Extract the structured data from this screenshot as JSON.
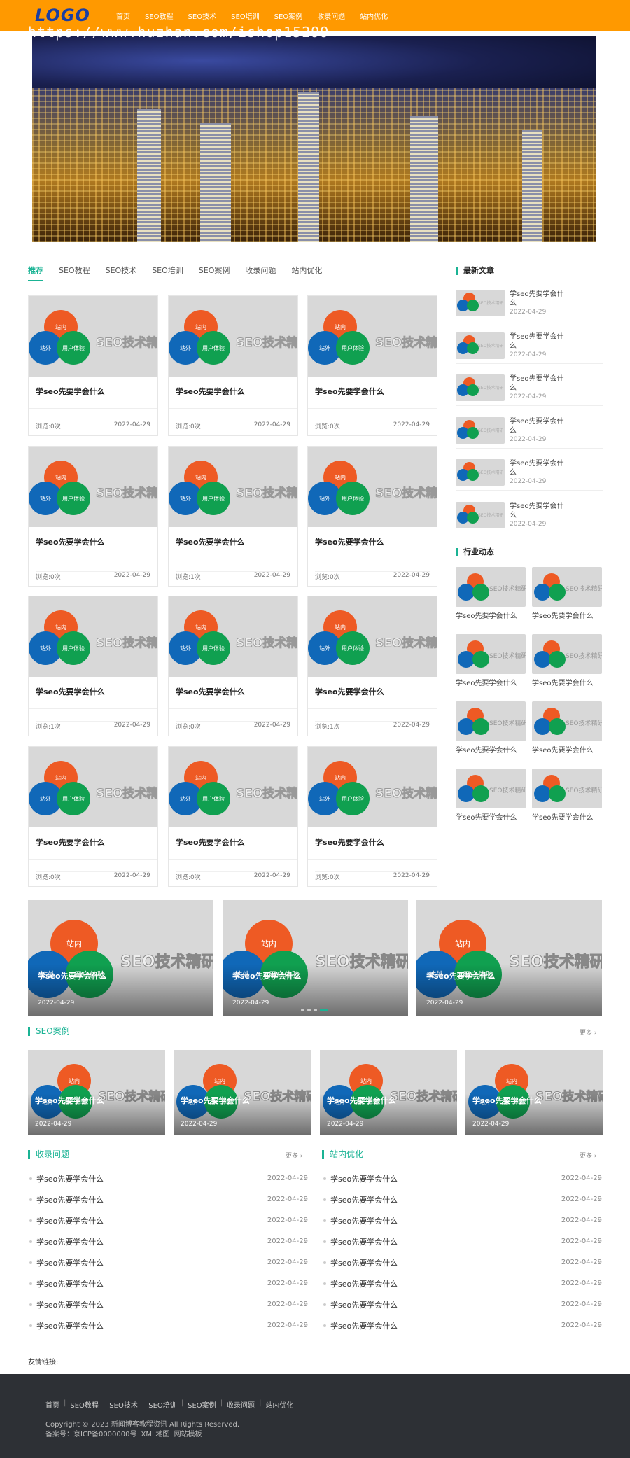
{
  "header": {
    "logo": "LOGO",
    "nav": [
      "首页",
      "SEO教程",
      "SEO技术",
      "SEO培训",
      "SEO案例",
      "收录问题",
      "站内优化"
    ]
  },
  "watermark": "https://www.huzhan.com/ishop15299",
  "tabs": [
    "推荐",
    "SEO教程",
    "SEO技术",
    "SEO培训",
    "SEO案例",
    "收录问题",
    "站内优化"
  ],
  "thumb": {
    "c1": "站内",
    "c2": "站外",
    "c3": "用户体验",
    "word": "SEO技术精研"
  },
  "cards": [
    {
      "title": "学seo先要学会什么",
      "views": "浏览:0次",
      "date": "2022-04-29"
    },
    {
      "title": "学seo先要学会什么",
      "views": "浏览:0次",
      "date": "2022-04-29"
    },
    {
      "title": "学seo先要学会什么",
      "views": "浏览:0次",
      "date": "2022-04-29"
    },
    {
      "title": "学seo先要学会什么",
      "views": "浏览:0次",
      "date": "2022-04-29"
    },
    {
      "title": "学seo先要学会什么",
      "views": "浏览:1次",
      "date": "2022-04-29"
    },
    {
      "title": "学seo先要学会什么",
      "views": "浏览:0次",
      "date": "2022-04-29"
    },
    {
      "title": "学seo先要学会什么",
      "views": "浏览:1次",
      "date": "2022-04-29"
    },
    {
      "title": "学seo先要学会什么",
      "views": "浏览:0次",
      "date": "2022-04-29"
    },
    {
      "title": "学seo先要学会什么",
      "views": "浏览:1次",
      "date": "2022-04-29"
    },
    {
      "title": "学seo先要学会什么",
      "views": "浏览:0次",
      "date": "2022-04-29"
    },
    {
      "title": "学seo先要学会什么",
      "views": "浏览:0次",
      "date": "2022-04-29"
    },
    {
      "title": "学seo先要学会什么",
      "views": "浏览:0次",
      "date": "2022-04-29"
    }
  ],
  "sidebar": {
    "latest_title": "最新文章",
    "latest": [
      {
        "title": "学seo先要学会什么",
        "date": "2022-04-29"
      },
      {
        "title": "学seo先要学会什么",
        "date": "2022-04-29"
      },
      {
        "title": "学seo先要学会什么",
        "date": "2022-04-29"
      },
      {
        "title": "学seo先要学会什么",
        "date": "2022-04-29"
      },
      {
        "title": "学seo先要学会什么",
        "date": "2022-04-29"
      },
      {
        "title": "学seo先要学会什么",
        "date": "2022-04-29"
      }
    ],
    "industry_title": "行业动态",
    "industry": [
      "学seo先要学会什么",
      "学seo先要学会什么",
      "学seo先要学会什么",
      "学seo先要学会什么",
      "学seo先要学会什么",
      "学seo先要学会什么",
      "学seo先要学会什么",
      "学seo先要学会什么"
    ]
  },
  "slides": [
    {
      "title": "学seo先要学会什么",
      "date": "2022-04-29"
    },
    {
      "title": "学seo先要学会什么",
      "date": "2022-04-29"
    },
    {
      "title": "学seo先要学会什么",
      "date": "2022-04-29"
    }
  ],
  "cases": {
    "title": "SEO案例",
    "more": "更多 ›",
    "items": [
      {
        "title": "学seo先要学会什么",
        "date": "2022-04-29"
      },
      {
        "title": "学seo先要学会什么",
        "date": "2022-04-29"
      },
      {
        "title": "学seo先要学会什么",
        "date": "2022-04-29"
      },
      {
        "title": "学seo先要学会什么",
        "date": "2022-04-29"
      }
    ]
  },
  "lists": [
    {
      "title": "收录问题",
      "more": "更多 ›",
      "items": [
        {
          "t": "学seo先要学会什么",
          "d": "2022-04-29"
        },
        {
          "t": "学seo先要学会什么",
          "d": "2022-04-29"
        },
        {
          "t": "学seo先要学会什么",
          "d": "2022-04-29"
        },
        {
          "t": "学seo先要学会什么",
          "d": "2022-04-29"
        },
        {
          "t": "学seo先要学会什么",
          "d": "2022-04-29"
        },
        {
          "t": "学seo先要学会什么",
          "d": "2022-04-29"
        },
        {
          "t": "学seo先要学会什么",
          "d": "2022-04-29"
        },
        {
          "t": "学seo先要学会什么",
          "d": "2022-04-29"
        }
      ]
    },
    {
      "title": "站内优化",
      "more": "更多 ›",
      "items": [
        {
          "t": "学seo先要学会什么",
          "d": "2022-04-29"
        },
        {
          "t": "学seo先要学会什么",
          "d": "2022-04-29"
        },
        {
          "t": "学seo先要学会什么",
          "d": "2022-04-29"
        },
        {
          "t": "学seo先要学会什么",
          "d": "2022-04-29"
        },
        {
          "t": "学seo先要学会什么",
          "d": "2022-04-29"
        },
        {
          "t": "学seo先要学会什么",
          "d": "2022-04-29"
        },
        {
          "t": "学seo先要学会什么",
          "d": "2022-04-29"
        },
        {
          "t": "学seo先要学会什么",
          "d": "2022-04-29"
        }
      ]
    }
  ],
  "friends": "友情链接:",
  "footer": {
    "nav": [
      "首页",
      "SEO教程",
      "SEO技术",
      "SEO培训",
      "SEO案例",
      "收录问题",
      "站内优化"
    ],
    "copyright": "Copyright © 2023 新闻博客教程资讯 All Rights Reserved.",
    "icp": "备案号：京ICP备0000000号",
    "xml": "XML地图",
    "tpl": "网站模板"
  },
  "colors": {
    "header": "#ff9900",
    "accent": "#1ab394",
    "footer": "#2d3035"
  }
}
